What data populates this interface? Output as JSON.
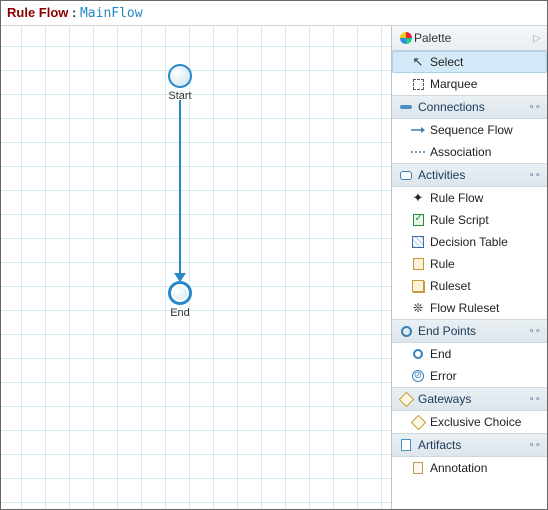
{
  "header": {
    "label": "Rule Flow",
    "colon": " : ",
    "name": "MainFlow"
  },
  "canvas": {
    "start_label": "Start",
    "end_label": "End"
  },
  "palette": {
    "title": "Palette",
    "sections": [
      {
        "key": "selection",
        "title": null,
        "items": [
          {
            "key": "select",
            "label": "Select",
            "interactable": true,
            "selected": true
          },
          {
            "key": "marquee",
            "label": "Marquee",
            "interactable": true,
            "selected": false
          }
        ]
      },
      {
        "key": "connections",
        "title": "Connections",
        "items": [
          {
            "key": "sequence-flow",
            "label": "Sequence Flow",
            "interactable": true
          },
          {
            "key": "association",
            "label": "Association",
            "interactable": true
          }
        ]
      },
      {
        "key": "activities",
        "title": "Activities",
        "items": [
          {
            "key": "rule-flow",
            "label": "Rule Flow",
            "interactable": true
          },
          {
            "key": "rule-script",
            "label": "Rule Script",
            "interactable": true
          },
          {
            "key": "decision-table",
            "label": "Decision Table",
            "interactable": true
          },
          {
            "key": "rule",
            "label": "Rule",
            "interactable": true
          },
          {
            "key": "ruleset",
            "label": "Ruleset",
            "interactable": true
          },
          {
            "key": "flow-ruleset",
            "label": "Flow Ruleset",
            "interactable": true
          }
        ]
      },
      {
        "key": "end-points",
        "title": "End Points",
        "items": [
          {
            "key": "end",
            "label": "End",
            "interactable": true
          },
          {
            "key": "error",
            "label": "Error",
            "interactable": true
          }
        ]
      },
      {
        "key": "gateways",
        "title": "Gateways",
        "items": [
          {
            "key": "exclusive-choice",
            "label": "Exclusive Choice",
            "interactable": true
          }
        ]
      },
      {
        "key": "artifacts",
        "title": "Artifacts",
        "items": [
          {
            "key": "annotation",
            "label": "Annotation",
            "interactable": true
          }
        ]
      }
    ]
  }
}
